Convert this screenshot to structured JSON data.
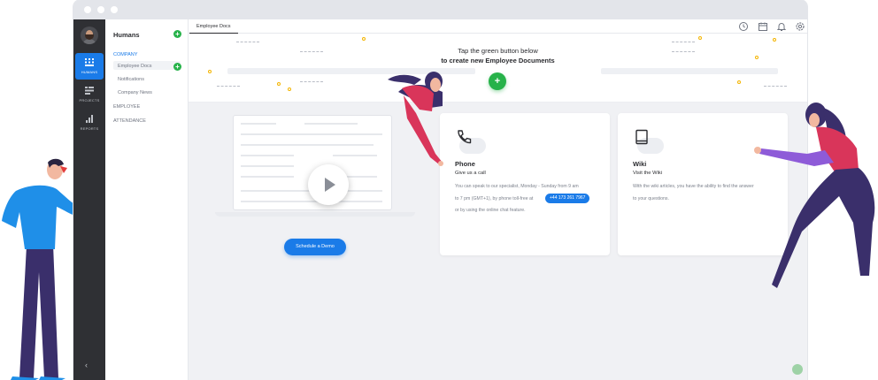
{
  "window": {
    "title_dots": 3
  },
  "rail": {
    "items": [
      {
        "label": "HUMANS",
        "icon": "grid-icon",
        "active": true
      },
      {
        "label": "PROJECTS",
        "icon": "layers-icon",
        "active": false
      },
      {
        "label": "REPORTS",
        "icon": "bar-chart-icon",
        "active": false
      }
    ],
    "collapse_icon": "‹"
  },
  "sidebar": {
    "title": "Humans",
    "items": [
      {
        "label": "COMPANY",
        "active": true
      },
      {
        "label": "Employee Docs",
        "sub": true
      },
      {
        "label": "Notifications",
        "sub": true
      },
      {
        "label": "Company News",
        "sub": true
      },
      {
        "label": "EMPLOYEE"
      },
      {
        "label": "ATTENDANCE"
      }
    ]
  },
  "tabbar": {
    "active_tab": "Employee Docs",
    "icons": [
      "clock-icon",
      "calendar-icon",
      "bell-icon",
      "settings-icon"
    ]
  },
  "hero": {
    "line1": "Tap the green button below",
    "line2": "to create new Employee Documents",
    "add_label": "+"
  },
  "demo": {
    "button_label": "Schedule a Demo"
  },
  "phone_card": {
    "title": "Phone",
    "subtitle": "Give us a call",
    "text1": "You can speak to our specialist, Monday - Sunday from 9 am",
    "text2": "to 7 pm (GMT+1), by phone toll-free at",
    "phone": "+44 173 261 7967",
    "text3": "or by using the online chat feature."
  },
  "wiki_card": {
    "title": "Wiki",
    "subtitle": "Visit the Wiki",
    "text1": "With the wiki articles, you have the ability to find the answer",
    "text2": "to your questions."
  },
  "colors": {
    "accent": "#1a7be8",
    "green": "#27b24a",
    "rail": "#2f3034"
  }
}
